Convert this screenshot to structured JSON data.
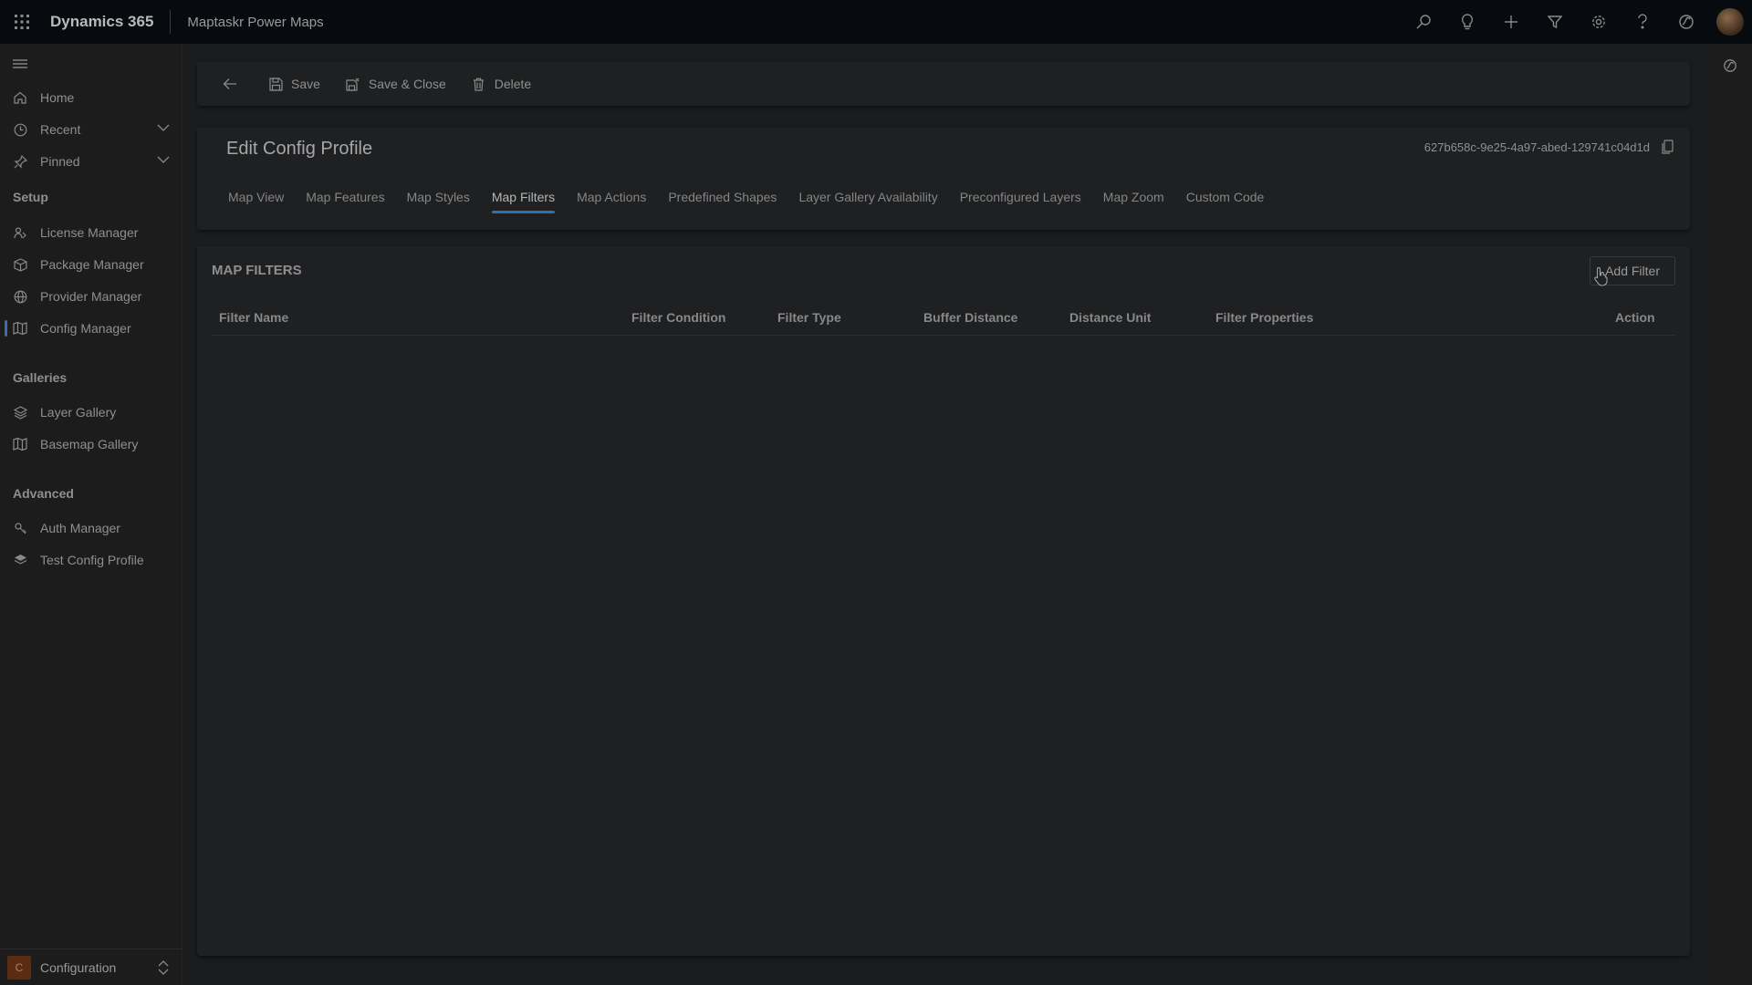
{
  "topbar": {
    "app_title": "Dynamics 365",
    "sub_title": "Maptaskr Power Maps",
    "icons": [
      "search-icon",
      "lightbulb-icon",
      "plus-icon",
      "filter-icon",
      "gear-icon",
      "help-icon",
      "copilot-icon",
      "avatar"
    ]
  },
  "sidebar": {
    "items_top": [
      {
        "label": "Home",
        "icon": "home-icon"
      },
      {
        "label": "Recent",
        "icon": "clock-icon"
      },
      {
        "label": "Pinned",
        "icon": "pin-icon"
      }
    ],
    "sections": [
      {
        "title": "Setup",
        "items": [
          {
            "label": "License Manager",
            "icon": "license-icon"
          },
          {
            "label": "Package Manager",
            "icon": "package-icon"
          },
          {
            "label": "Provider Manager",
            "icon": "globe-icon"
          },
          {
            "label": "Config Manager",
            "icon": "map-icon",
            "active": true
          }
        ]
      },
      {
        "title": "Galleries",
        "items": [
          {
            "label": "Layer Gallery",
            "icon": "layers-icon"
          },
          {
            "label": "Basemap Gallery",
            "icon": "map-icon"
          }
        ]
      },
      {
        "title": "Advanced",
        "items": [
          {
            "label": "Auth Manager",
            "icon": "auth-icon"
          },
          {
            "label": "Test Config Profile",
            "icon": "test-icon"
          }
        ]
      }
    ],
    "area": {
      "badge": "C",
      "label": "Configuration"
    }
  },
  "commandbar": {
    "save": "Save",
    "save_close": "Save & Close",
    "delete": "Delete"
  },
  "header": {
    "title": "Edit Config Profile",
    "record_id": "627b658c-9e25-4a97-abed-129741c04d1d",
    "tabs": [
      "Map View",
      "Map Features",
      "Map Styles",
      "Map Filters",
      "Map Actions",
      "Predefined Shapes",
      "Layer Gallery Availability",
      "Preconfigured Layers",
      "Map Zoom",
      "Custom Code"
    ],
    "active_tab": "Map Filters"
  },
  "filters": {
    "section_title": "MAP FILTERS",
    "add_button": "Add Filter",
    "columns": [
      "Filter Name",
      "Filter Condition",
      "Filter Type",
      "Buffer Distance",
      "Distance Unit",
      "Filter Properties",
      "Action"
    ],
    "rows": []
  },
  "colors": {
    "accent": "#2f6fb3",
    "topbar": "#070a0f",
    "background": "#1b1c1e",
    "area_badge": "#5a2d12"
  }
}
